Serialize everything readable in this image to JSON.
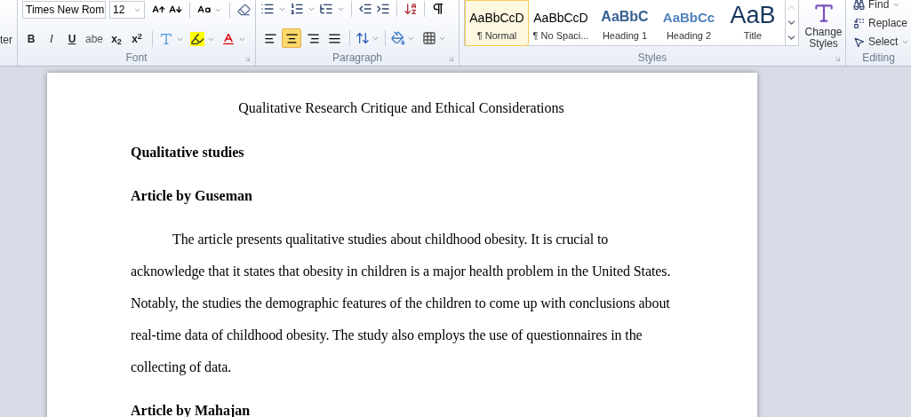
{
  "ribbon": {
    "clipboard_fragment": "ter",
    "font": {
      "label": "Font",
      "font_name": "Times New Rom",
      "font_size": "12",
      "format_buttons": [
        {
          "kind": "bold",
          "text": "B"
        },
        {
          "kind": "italic",
          "text": "I"
        },
        {
          "kind": "underline",
          "text": "U"
        },
        {
          "kind": "strike",
          "text": "abe"
        },
        {
          "kind": "subscript",
          "text": "x$_{2}$"
        },
        {
          "kind": "superscript",
          "text": "x$^{2}$"
        }
      ]
    },
    "paragraph": {
      "label": "Paragraph",
      "alignments": [
        {
          "kind": "left",
          "selected": false
        },
        {
          "kind": "center",
          "selected": true
        },
        {
          "kind": "right",
          "selected": false
        },
        {
          "kind": "justify",
          "selected": false
        }
      ]
    },
    "styles": {
      "label": "Styles",
      "items": [
        {
          "kind": "normal",
          "preview": "AaBbCcD",
          "label": "¶ Normal",
          "selected": true
        },
        {
          "kind": "normal",
          "preview": "AaBbCcD",
          "label": "¶ No Spaci...",
          "selected": false
        },
        {
          "kind": "heading1",
          "preview": "AaBbC",
          "label": "Heading 1",
          "selected": false
        },
        {
          "kind": "heading2",
          "preview": "AaBbCc",
          "label": "Heading 2",
          "selected": false
        },
        {
          "kind": "title",
          "preview": "AaB",
          "label": "Title",
          "selected": false
        }
      ],
      "change_styles": "Change Styles"
    },
    "editing": {
      "label": "Editing",
      "items": [
        {
          "kind": "find",
          "label": "Find"
        },
        {
          "kind": "replace",
          "label": "Replace"
        },
        {
          "kind": "select",
          "label": "Select"
        }
      ]
    }
  },
  "document": {
    "title": "Qualitative Research Critique and Ethical Considerations",
    "blocks": [
      {
        "kind": "heading",
        "text": "Qualitative studies"
      },
      {
        "kind": "heading",
        "text": "Article by Guseman"
      },
      {
        "kind": "paragraph",
        "text": "The article presents qualitative studies about childhood obesity. It is crucial to acknowledge that it states that obesity in children is a major health problem in the United States. Notably, the studies the demographic features of the children to come up with conclusions about real-time data of childhood obesity. The study also employs the use of questionnaires in the collecting of data."
      },
      {
        "kind": "heading",
        "text": "Article by Mahajan"
      }
    ]
  }
}
